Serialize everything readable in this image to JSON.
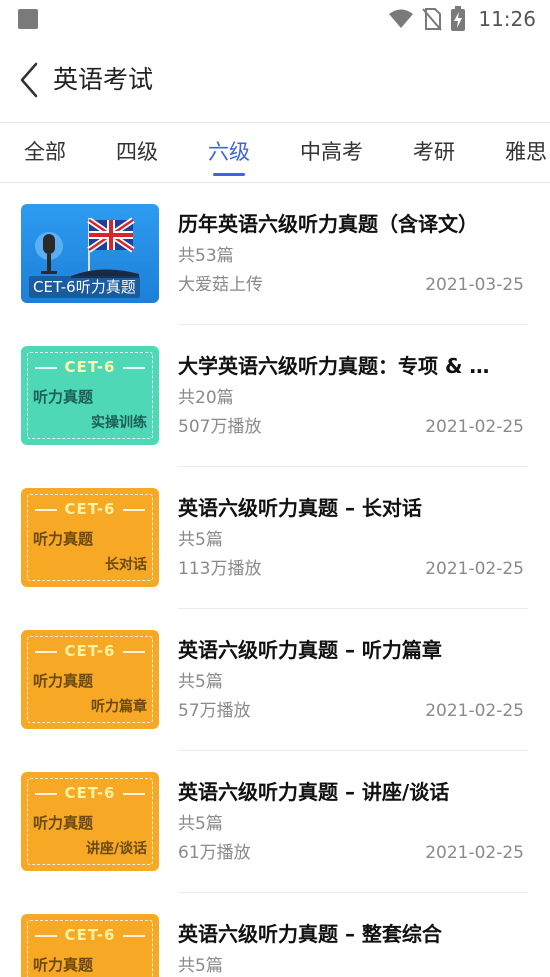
{
  "status_bar": {
    "time": "11:26"
  },
  "header": {
    "title": "英语考试"
  },
  "tabs": [
    {
      "label": "全部"
    },
    {
      "label": "四级"
    },
    {
      "label": "六级"
    },
    {
      "label": "中高考"
    },
    {
      "label": "考研"
    },
    {
      "label": "雅思"
    }
  ],
  "active_tab": "六级",
  "items": [
    {
      "title": "历年英语六级听力真题（含译文）",
      "count": "共53篇",
      "meta": "大爱菇上传",
      "date": "2021-03-25",
      "thumb_caption": "CET-6听力真题"
    },
    {
      "title": "大学英语六级听力真题：专项 & …",
      "count": "共20篇",
      "meta": "507万播放",
      "date": "2021-02-25",
      "thumb_cet": "CET-6",
      "thumb_line1": "听力真题",
      "thumb_line2": "实操训练"
    },
    {
      "title": "英语六级听力真题 – 长对话",
      "count": "共5篇",
      "meta": "113万播放",
      "date": "2021-02-25",
      "thumb_cet": "CET-6",
      "thumb_line1": "听力真题",
      "thumb_line2": "长对话"
    },
    {
      "title": "英语六级听力真题 – 听力篇章",
      "count": "共5篇",
      "meta": "57万播放",
      "date": "2021-02-25",
      "thumb_cet": "CET-6",
      "thumb_line1": "听力真题",
      "thumb_line2": "听力篇章"
    },
    {
      "title": "英语六级听力真题 – 讲座/谈话",
      "count": "共5篇",
      "meta": "61万播放",
      "date": "2021-02-25",
      "thumb_cet": "CET-6",
      "thumb_line1": "听力真题",
      "thumb_line2": "讲座/谈话"
    },
    {
      "title": "英语六级听力真题 – 整套综合",
      "count": "共5篇",
      "thumb_cet": "CET-6",
      "thumb_line1": "听力真题"
    }
  ],
  "colors": {
    "accent": "#3f63e0",
    "thumb_blue": "#2d9cf0",
    "thumb_green": "#4ed8b6",
    "thumb_orange": "#f7a825"
  },
  "icons": {
    "status_left": "notification-square-icon",
    "wifi": "wifi-icon",
    "no_sim": "no-sim-icon",
    "battery": "battery-charging-icon",
    "back": "back-arrow-icon"
  }
}
